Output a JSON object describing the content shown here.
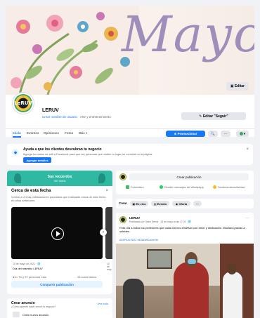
{
  "cover": {
    "title": "Mayo",
    "edit_label": "Editar"
  },
  "page": {
    "name": "LERUV",
    "subtitle_link": "Crear nombre de usuario",
    "subtitle_rest": " · Arte y entretenimiento",
    "follow_label": "✎ Editar \"Seguir\"",
    "logo_text": "LeRUV"
  },
  "tabs": [
    {
      "label": "Inicio"
    },
    {
      "label": "Eventos"
    },
    {
      "label": "Opiniones"
    },
    {
      "label": "Fotos"
    },
    {
      "label": "Más ▾"
    }
  ],
  "toolbar": {
    "promote_label": "⊕ Promocionar",
    "search_icon": "🔍",
    "more_icon": "···",
    "profile_icon": "▾"
  },
  "help": {
    "title": "Ayuda a que los clientes descubran tu negocio",
    "desc": "Agrega los datos de wifi a Facebook para que las personas que visiten tu lugar se conecten a la página.",
    "button": "Agregar detalles",
    "close": "×"
  },
  "memory": {
    "banner_title": "Sus recuerdos",
    "banner_sub": "Ver todos",
    "heading": "Cerca de esta fecha",
    "close": "×",
    "paragraph": "Vuelve a ver las publicaciones populares que realizaste cerca de esta fecha en años anteriores.",
    "date": "10 de mayo de 2021 · 🌐",
    "caption": "Día del maestro LERUV",
    "peek_caption": "10 de may",
    "reactions": "Tú y 57 personas más",
    "comments": "28 comentarios",
    "share": "Compartir publicación",
    "next_icon": "›"
  },
  "create_ad": {
    "title": "Crear anuncio",
    "sub": "¿Cómo quieres hacer crecer tu negocio?",
    "see_all": "Ver todo",
    "new_label": "Crear nuevo anuncio"
  },
  "composer": {
    "placeholder": "Crear publicación",
    "actions": [
      {
        "label": "Foto/video",
        "color": "#45bd62"
      },
      {
        "label": "Recibir mensajes de WhatsApp",
        "color": "#25d366"
      },
      {
        "label": "Sentimiento/actividad",
        "color": "#f7b928"
      }
    ]
  },
  "filters": {
    "label": "Crear",
    "chips": [
      {
        "label": "▣ En vivo"
      },
      {
        "label": "▤ Evento"
      },
      {
        "label": "◉ Oferta"
      },
      {
        "label": "···"
      }
    ]
  },
  "post": {
    "name": "LERUV",
    "meta": "Publicado por Gabri Serna · 15 de mayo a las 17:21 · 🌐",
    "more": "···",
    "text": "Feliz día a todos los profesores que cada día nos enseñan con amor y dedicación. Muchas gracias a ustedes.",
    "hashtags": "#LERUV2022 #DíaDelDocente"
  }
}
